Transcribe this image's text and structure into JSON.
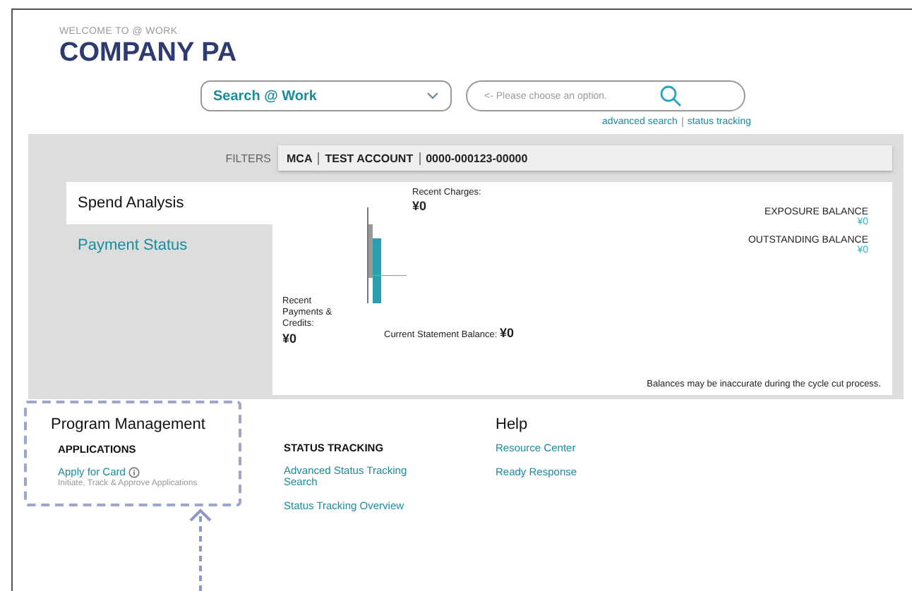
{
  "header": {
    "welcome": "WELCOME TO  @ WORK",
    "company": "COMPANY PA"
  },
  "search": {
    "scope": "Search @ Work",
    "placeholder": "<- Please choose an option.",
    "links": [
      "advanced search",
      "status tracking"
    ]
  },
  "filters": {
    "label": "FILTERS",
    "values": [
      "MCA",
      "TEST ACCOUNT",
      "0000-000123-00000"
    ]
  },
  "tabs": [
    {
      "label": "Spend Analysis",
      "selected": true
    },
    {
      "label": "Payment Status",
      "selected": false
    }
  ],
  "summary": {
    "charges_label": "Recent Charges:",
    "charges_value": "¥0",
    "payments_label": "Recent Payments & Credits:",
    "payments_value": "¥0",
    "statement_label": "Current Statement Balance:",
    "statement_value": "¥0",
    "balances": [
      {
        "label": "EXPOSURE BALANCE",
        "value": "¥0"
      },
      {
        "label": "OUTSTANDING BALANCE",
        "value": "¥0"
      }
    ],
    "note": "Balances may be inaccurate during the cycle cut process."
  },
  "program_management": {
    "title": "Program Management",
    "applications": {
      "heading": "APPLICATIONS",
      "link": "Apply for Card",
      "description": "Initiate, Track & Approve Applications"
    },
    "status_tracking": {
      "heading": "STATUS TRACKING",
      "links": [
        "Advanced Status Tracking Search",
        "Status Tracking Overview"
      ]
    }
  },
  "help": {
    "title": "Help",
    "links": [
      "Resource Center",
      "Ready Response"
    ]
  }
}
